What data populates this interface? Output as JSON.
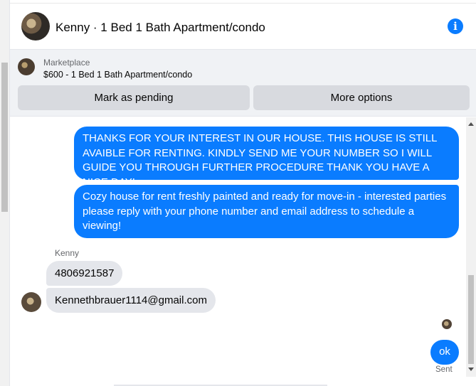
{
  "header": {
    "title": "Kenny · 1 Bed 1 Bath Apartment/condo",
    "info_icon": "i"
  },
  "marketplace": {
    "label": "Marketplace",
    "item": "$600 - 1 Bed 1 Bath Apartment/condo",
    "pending_button": "Mark as pending",
    "more_button": "More options"
  },
  "messages": {
    "outgoing_1": "THANKS FOR YOUR INTEREST IN OUR HOUSE. THIS HOUSE IS STILL AVAIBLE FOR RENTING. KINDLY SEND ME YOUR NUMBER SO I WILL GUIDE YOU THROUGH FURTHER PROCEDURE THANK YOU HAVE A NICE DAY!",
    "outgoing_2": "Cozy house for rent freshly painted and ready for move-in - interested parties please reply with your phone number and email address to schedule a viewing!",
    "sender_name": "Kenny",
    "incoming_1": "4806921587",
    "incoming_2": "Kennethbrauer1114@gmail.com",
    "outgoing_3": "ok",
    "status": "Sent"
  },
  "colors": {
    "outgoing_bubble": "#0a7cff",
    "incoming_bubble": "#e4e6eb",
    "accent": "#0a7cff"
  }
}
